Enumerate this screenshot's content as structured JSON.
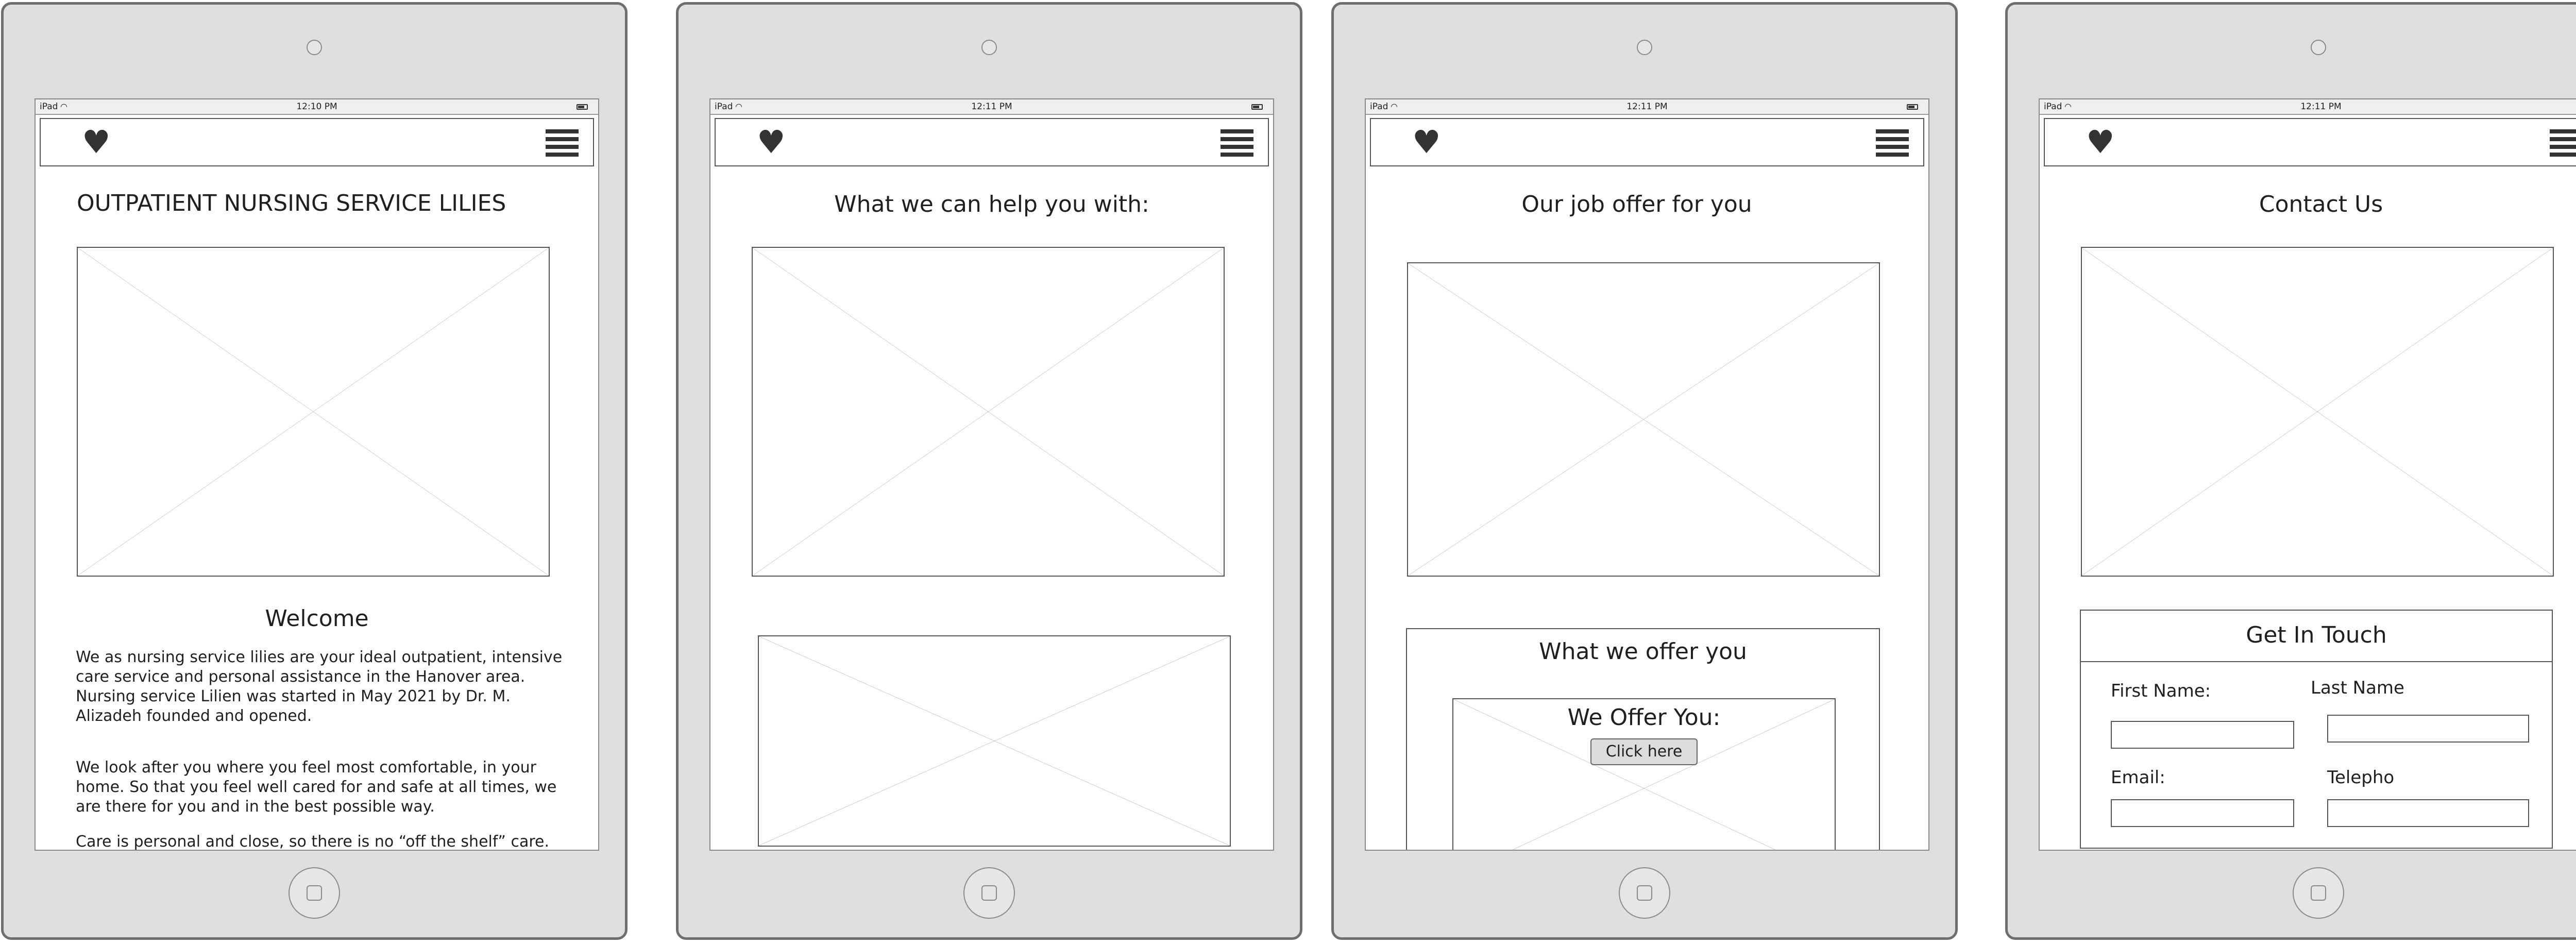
{
  "statusbar": {
    "carrier": "iPad",
    "wifi_icon": "wifi-icon",
    "battery_icon": "battery-icon"
  },
  "devices": [
    {
      "time": "12:10 PM"
    },
    {
      "time": "12:11 PM"
    },
    {
      "time": "12:11 PM"
    },
    {
      "time": "12:11 PM"
    }
  ],
  "navbar": {
    "logo_icon": "heart-icon",
    "logo_glyph": "♥",
    "menu_icon": "hamburger-menu-icon"
  },
  "home": {
    "title": "OUTPATIENT NURSING SERVICE LILIES",
    "welcome": "Welcome",
    "paragraphs": [
      "We as nursing service lilies are your ideal outpatient, intensive care service and personal assistance in the Hanover area. Nursing service Lilien was started in May 2021 by Dr. M. Alizadeh founded and opened.",
      "We look after you where you feel most comfortable, in your home. So that you feel well cared for and safe at all times, we are there for you and in the best possible way.",
      "Care is personal and close, so there is no “off the shelf” care."
    ]
  },
  "services": {
    "title": "What we can help you with:"
  },
  "jobs": {
    "title": "Our job offer for you",
    "offer_heading": "What we offer you",
    "inner_heading": "We Offer You:",
    "button_label": "Click here"
  },
  "contact": {
    "title": "Contact Us",
    "form_title": "Get In Touch",
    "first_name_label": "First Name:",
    "last_name_label": "Last Name",
    "email_label": "Email:",
    "phone_label": "Telepho"
  },
  "colors": {
    "device_frame": "#dfdfdf",
    "device_border": "#6e6e6e",
    "icon": "#333333"
  }
}
